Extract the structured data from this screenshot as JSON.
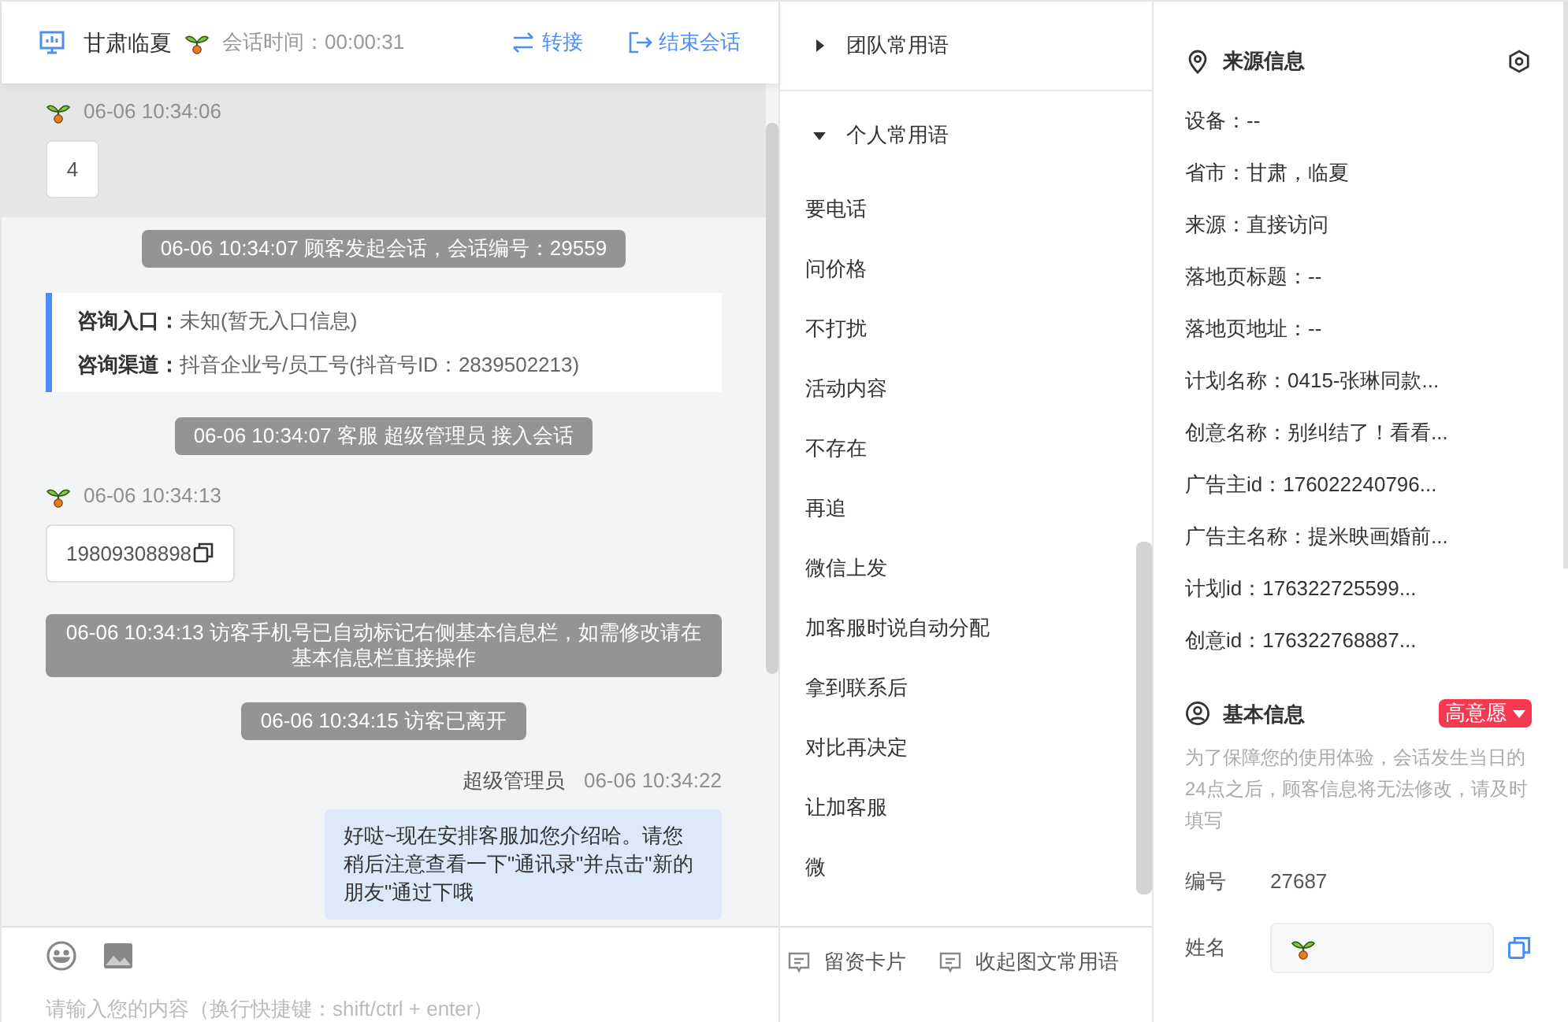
{
  "header": {
    "name": "甘肃临夏",
    "session_time": "会话时间：00:00:31",
    "actions": [
      {
        "kind": "transfer",
        "label": "转接"
      },
      {
        "kind": "end",
        "label": "结束会话"
      }
    ]
  },
  "messages": [
    {
      "kind": "visitor",
      "time": "06-06 10:34:06",
      "text": "4",
      "highlighted": true,
      "copyable": false
    },
    {
      "kind": "system",
      "text": "06-06 10:34:07 顾客发起会话，会话编号：29559"
    },
    {
      "kind": "info",
      "entries": [
        {
          "label": "咨询入口：",
          "value": "未知(暂无入口信息)"
        },
        {
          "label": "咨询渠道：",
          "value": "抖音企业号/员工号(抖音号ID：2839502213)"
        }
      ]
    },
    {
      "kind": "system",
      "text": "06-06 10:34:07 客服 超级管理员 接入会话"
    },
    {
      "kind": "visitor",
      "time": "06-06 10:34:13",
      "text": "19809308898",
      "highlighted": false,
      "copyable": true
    },
    {
      "kind": "system",
      "text": "06-06 10:34:13 访客手机号已自动标记右侧基本信息栏，如需修改请在基本信息栏直接操作"
    },
    {
      "kind": "system",
      "text": "06-06 10:34:15 访客已离开"
    },
    {
      "kind": "agent",
      "name": "超级管理员",
      "time": "06-06 10:34:22",
      "text": "好哒~现在安排客服加您介绍哈。请您稍后注意查看一下\"通讯录\"并点击\"新的朋友\"通过下哦"
    }
  ],
  "composer": {
    "placeholder": "请输入您的内容（换行快捷键：shift/ctrl + enter）"
  },
  "phrases": {
    "groups": [
      {
        "label": "团队常用语",
        "expanded": false
      },
      {
        "label": "个人常用语",
        "expanded": true,
        "items": [
          "要电话",
          "问价格",
          "不打扰",
          "活动内容",
          "不存在",
          "再追",
          "微信上发",
          "加客服时说自动分配",
          "拿到联系后",
          "对比再决定",
          "让加客服",
          "微"
        ]
      }
    ],
    "footer": [
      "留资卡片",
      "收起图文常用语"
    ]
  },
  "source_info": {
    "title": "来源信息",
    "rows": [
      "设备：--",
      "省市：甘肃，临夏",
      "来源：直接访问",
      "落地页标题：--",
      "落地页地址：--",
      "计划名称：0415-张琳同款...",
      "创意名称：别纠结了！看看...",
      "广告主id：176022240796...",
      "广告主名称：提米映画婚前...",
      "计划id：176322725599...",
      "创意id：176322768887..."
    ]
  },
  "basic_info": {
    "title": "基本信息",
    "tag": "高意愿",
    "note": "为了保障您的使用体验，会话发生当日的24点之后，顾客信息将无法修改，请及时填写",
    "fields": [
      {
        "kind": "text",
        "label": "编号",
        "value": "27687"
      },
      {
        "kind": "input",
        "label": "姓名"
      }
    ]
  }
}
